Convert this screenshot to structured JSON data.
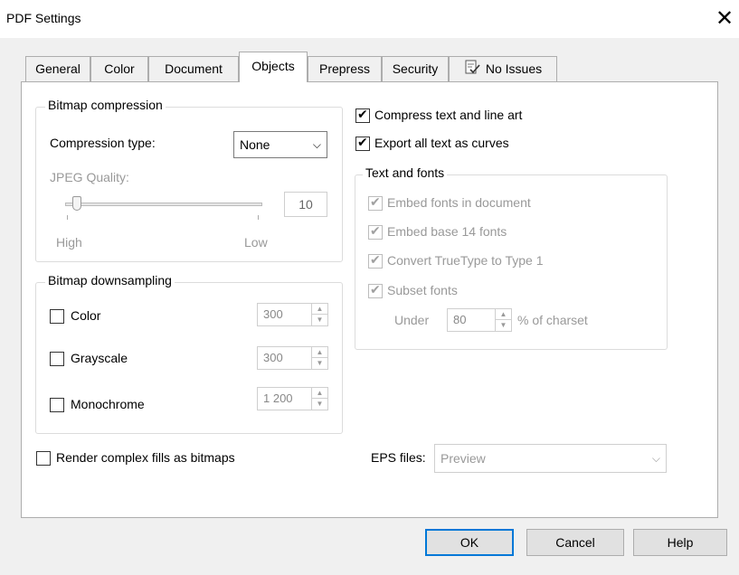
{
  "window": {
    "title": "PDF Settings",
    "close_glyph": "✕"
  },
  "tabs": [
    {
      "label": "General"
    },
    {
      "label": "Color"
    },
    {
      "label": "Document"
    },
    {
      "label": "Objects"
    },
    {
      "label": "Prepress"
    },
    {
      "label": "Security"
    },
    {
      "label": "No Issues",
      "icon": "checklist-icon"
    }
  ],
  "active_tab": "Objects",
  "bitmap_compression": {
    "title": "Bitmap compression",
    "compression_type_label": "Compression type:",
    "compression_type_value": "None",
    "jpeg_quality_label": "JPEG Quality:",
    "jpeg_quality_value": "10",
    "slider_high": "High",
    "slider_low": "Low",
    "slider_level_fraction": 0.1
  },
  "bitmap_downsampling": {
    "title": "Bitmap downsampling",
    "items": [
      {
        "label": "Color",
        "checked": false,
        "value": "300"
      },
      {
        "label": "Grayscale",
        "checked": false,
        "value": "300"
      },
      {
        "label": "Monochrome",
        "checked": false,
        "value": "1 200"
      }
    ]
  },
  "render_complex": {
    "label": "Render complex fills as bitmaps",
    "checked": false
  },
  "compress_text": {
    "label": "Compress text and line art",
    "checked": true
  },
  "export_curves": {
    "label": "Export all text as curves",
    "checked": true
  },
  "text_fonts": {
    "title": "Text and fonts",
    "embed_fonts": "Embed fonts in document",
    "embed_base14": "Embed base 14 fonts",
    "convert_truetype": "Convert TrueType to Type 1",
    "subset_fonts": "Subset fonts",
    "under_label": "Under",
    "under_value": "80",
    "charset_label": "% of charset"
  },
  "eps_files": {
    "label": "EPS files:",
    "value": "Preview"
  },
  "buttons": {
    "ok": "OK",
    "cancel": "Cancel",
    "help": "Help"
  },
  "colors": {
    "accent": "#0078d7",
    "window_bg": "#f0f0f0",
    "panel_bg": "#ffffff"
  }
}
